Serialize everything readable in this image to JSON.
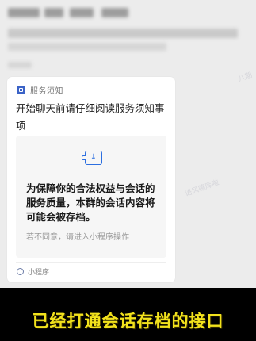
{
  "notice_card": {
    "service_name": "服务须知",
    "title": "开始聊天前请仔细阅读服务须知事项",
    "panel_text": "为保障你的合法权益与会话的服务质量，本群的会话内容将可能会被存档。",
    "panel_subtext": "若不同意，请进入小程序操作",
    "miniprogram_label": "小程序",
    "accent_color": "#2c6fe0"
  },
  "subtitle": {
    "text": "已经打通会话存档的接口",
    "color": "#f2e21c"
  },
  "watermarks": {
    "right_top": "八期",
    "middle": "语风德库啦"
  }
}
